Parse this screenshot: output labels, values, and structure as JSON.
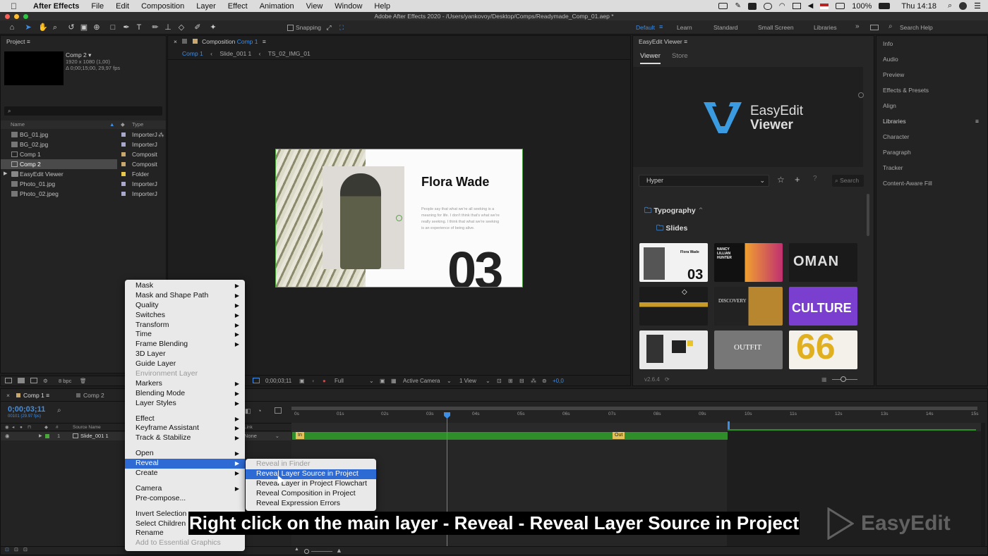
{
  "mac_menu": {
    "apple": "",
    "app": "After Effects",
    "items": [
      "File",
      "Edit",
      "Composition",
      "Layer",
      "Effect",
      "Animation",
      "View",
      "Window",
      "Help"
    ],
    "battery": "100%",
    "clock": "Thu 14:18"
  },
  "window_title": "Adobe After Effects 2020 - /Users/yankovoy/Desktop/Comps/Readymade_Comp_01.aep *",
  "toolbar": {
    "snapping": "Snapping",
    "workspaces": [
      "Default",
      "Learn",
      "Standard",
      "Small Screen",
      "Libraries"
    ],
    "search_help": "Search Help"
  },
  "project": {
    "title": "Project",
    "comp_name": "Comp 2 ▾",
    "comp_info1": "1920 x 1080 (1,00)",
    "comp_info2": "Δ 0;00;15;00, 29,97 fps",
    "search_placeholder": "",
    "col_name": "Name",
    "col_type": "Type",
    "items": [
      {
        "name": "BG_01.jpg",
        "type": "ImporterJ"
      },
      {
        "name": "BG_02.jpg",
        "type": "ImporterJ"
      },
      {
        "name": "Comp 1",
        "type": "Composit"
      },
      {
        "name": "Comp 2",
        "type": "Composit"
      },
      {
        "name": "EasyEdit Viewer",
        "type": "Folder"
      },
      {
        "name": "Photo_01.jpg",
        "type": "ImporterJ"
      },
      {
        "name": "Photo_02.jpeg",
        "type": "ImporterJ"
      }
    ],
    "bpc": "8 bpc"
  },
  "composition": {
    "panel_title": "Composition",
    "panel_comp": "Comp 1",
    "breadcrumbs": [
      "Comp 1",
      "Slide_001 1",
      "TS_02_IMG_01"
    ],
    "slide_title": "Flora Wade",
    "slide_text": "People say that what we're all seeking is a meaning for life. I don't think that's what we're really seeking. I think that what we're seeking is an experience of being alive.",
    "slide_number": "03",
    "timecode": "0;00;03;11",
    "resolution": "Full",
    "camera": "Active Camera",
    "views": "1 View",
    "exposure": "+0,0"
  },
  "easyedit": {
    "panel_title": "EasyEdit Viewer",
    "tabs": [
      "Viewer",
      "Store"
    ],
    "logo_line1": "EasyEdit",
    "logo_line2": "Viewer",
    "dropdown": "Hyper",
    "search_placeholder": "Search",
    "folder1": "Typography",
    "folder2": "Slides",
    "thumbs": [
      {
        "label": "Flora Wade",
        "bg": "#f2f2f2"
      },
      {
        "label": "NANCY LILLIAN HUNTER",
        "bg": "#111"
      },
      {
        "label": "OMAN",
        "bg": "#1a1a1a"
      },
      {
        "label": "",
        "bg": "#1b1b1b"
      },
      {
        "label": "DISCOVERY",
        "bg": "#222"
      },
      {
        "label": "CULTURE",
        "bg": "#7b3fd0"
      },
      {
        "label": "",
        "bg": "#e9e9e9"
      },
      {
        "label": "OUTFIT",
        "bg": "#777"
      },
      {
        "label": "66",
        "bg": "#f4f0ea"
      }
    ],
    "version": "v2.6.4"
  },
  "right_panels": {
    "items": [
      "Info",
      "Audio",
      "Preview",
      "Effects & Presets",
      "Align",
      "Libraries",
      "Character",
      "Paragraph",
      "Tracker",
      "Content-Aware Fill"
    ]
  },
  "timeline": {
    "tabs": [
      "Comp 1",
      "Comp 2"
    ],
    "timecode": "0;00;03;11",
    "frame_info": "00101 (29.97 fps)",
    "col_source": "Source Name",
    "col_parent": "Link",
    "layer_num": "1",
    "layer_name": "Slide_001 1",
    "layer_parent": "None",
    "ruler": [
      "0s",
      "01s",
      "02s",
      "03s",
      "04s",
      "05s",
      "06s",
      "07s",
      "08s",
      "09s",
      "10s",
      "11s",
      "12s",
      "13s",
      "14s",
      "15s"
    ],
    "marker_in": "In",
    "marker_out": "Out"
  },
  "context_menu": {
    "items": [
      {
        "label": "Mask",
        "sub": true
      },
      {
        "label": "Mask and Shape Path",
        "sub": true
      },
      {
        "label": "Quality",
        "sub": true
      },
      {
        "label": "Switches",
        "sub": true
      },
      {
        "label": "Transform",
        "sub": true
      },
      {
        "label": "Time",
        "sub": true
      },
      {
        "label": "Frame Blending",
        "sub": true
      },
      {
        "label": "3D Layer"
      },
      {
        "label": "Guide Layer"
      },
      {
        "label": "Environment Layer",
        "disabled": true
      },
      {
        "label": "Markers",
        "sub": true
      },
      {
        "label": "Blending Mode",
        "sub": true
      },
      {
        "label": "Layer Styles",
        "sub": true
      },
      {
        "sep": true
      },
      {
        "label": "Effect",
        "sub": true
      },
      {
        "label": "Keyframe Assistant",
        "sub": true
      },
      {
        "label": "Track & Stabilize",
        "sub": true
      },
      {
        "sep": true
      },
      {
        "label": "Open",
        "sub": true
      },
      {
        "label": "Reveal",
        "sub": true,
        "selected": true
      },
      {
        "label": "Create",
        "sub": true
      },
      {
        "sep": true
      },
      {
        "label": "Camera",
        "sub": true
      },
      {
        "label": "Pre-compose..."
      },
      {
        "sep": true
      },
      {
        "label": "Invert Selection"
      },
      {
        "label": "Select Children"
      },
      {
        "label": "Rename"
      },
      {
        "label": "Add to Essential Graphics",
        "disabled": true
      }
    ],
    "submenu": [
      {
        "label": "Reveal in Finder",
        "disabled": true
      },
      {
        "label": "Reveal Layer Source in Project",
        "selected": true
      },
      {
        "label": "Reveal Layer in Project Flowchart"
      },
      {
        "label": "Reveal Composition in Project"
      },
      {
        "label": "Reveal Expression Errors"
      }
    ]
  },
  "caption": "Right click on the main layer - Reveal - Reveal Layer Source in Project",
  "watermark": "EasyEdit"
}
